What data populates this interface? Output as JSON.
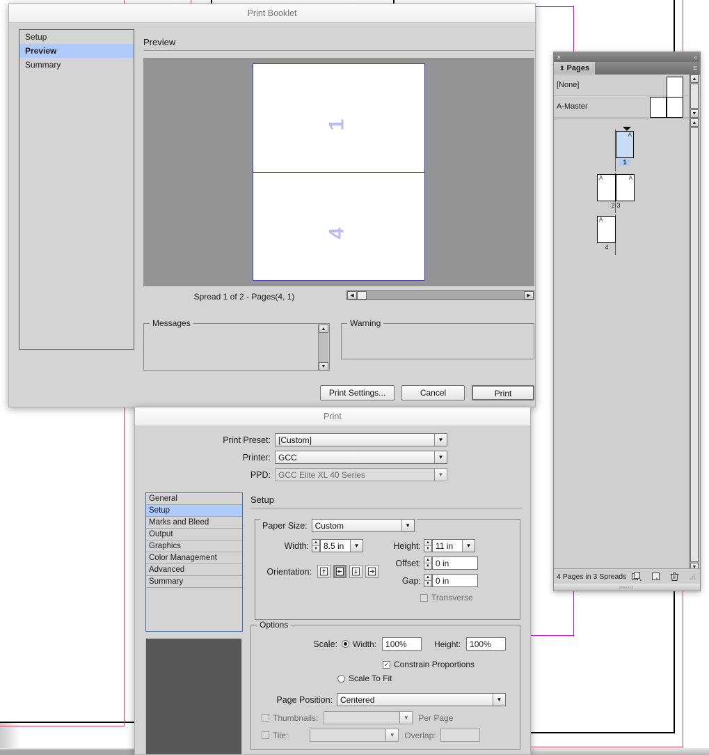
{
  "canvas": {
    "guide_magenta": "#e600e6",
    "guide_violet": "#8a2be2",
    "guide_red": "#e8415c",
    "page_border": "#000000"
  },
  "print_booklet": {
    "title": "Print Booklet",
    "nav_items": [
      {
        "label": "Setup",
        "selected": false
      },
      {
        "label": "Preview",
        "selected": true
      },
      {
        "label": "Summary",
        "selected": false
      }
    ],
    "preview_label": "Preview",
    "spread_caption": "Spread 1 of 2 - Pages(4, 1)",
    "preview_page_top": "1",
    "preview_page_bottom": "4",
    "messages_legend": "Messages",
    "messages_value": "",
    "warning_legend": "Warning",
    "warning_value": "",
    "buttons": {
      "print_settings": "Print Settings...",
      "cancel": "Cancel",
      "print": "Print"
    },
    "scroll_left_icon": "◀",
    "scroll_right_icon": "▶",
    "scroll_up_icon": "▲",
    "scroll_down_icon": "▼"
  },
  "print_dialog": {
    "title": "Print",
    "preset_label": "Print Preset:",
    "preset_value": "[Custom]",
    "printer_label": "Printer:",
    "printer_value": "GCC",
    "ppd_label": "PPD:",
    "ppd_value": "GCC Elite XL 40 Series",
    "nav_items": [
      {
        "label": "General",
        "selected": false
      },
      {
        "label": "Setup",
        "selected": true
      },
      {
        "label": "Marks and Bleed",
        "selected": false
      },
      {
        "label": "Output",
        "selected": false
      },
      {
        "label": "Graphics",
        "selected": false
      },
      {
        "label": "Color Management",
        "selected": false
      },
      {
        "label": "Advanced",
        "selected": false
      },
      {
        "label": "Summary",
        "selected": false
      }
    ],
    "panel_title": "Setup",
    "paper": {
      "legend": "Paper Size:",
      "paper_size_value": "Custom",
      "width_label": "Width:",
      "width_value": "8.5 in",
      "height_label": "Height:",
      "height_value": "11 in",
      "offset_label": "Offset:",
      "offset_value": "0 in",
      "gap_label": "Gap:",
      "gap_value": "0 in",
      "orientation_label": "Orientation:",
      "transverse_label": "Transverse",
      "transverse_checked": false,
      "orientation_selected_index": 1
    },
    "options": {
      "legend": "Options",
      "scale_label": "Scale:",
      "scale_width_label": "Width:",
      "scale_width_value": "100%",
      "scale_height_label": "Height:",
      "scale_height_value": "100%",
      "constrain_label": "Constrain Proportions",
      "constrain_checked": true,
      "check_glyph": "✓",
      "scale_to_fit_label": "Scale To Fit",
      "scale_mode": "width",
      "page_position_label": "Page Position:",
      "page_position_value": "Centered",
      "thumbnails_label": "Thumbnails:",
      "thumbnails_value": "",
      "per_page_label": "Per Page",
      "tile_label": "Tile:",
      "tile_value": "",
      "overlap_label": "Overlap:",
      "overlap_value": ""
    },
    "dropdown_arrow": "▼"
  },
  "pages_panel": {
    "close_icon": "✕",
    "collapse_icon": "«",
    "tab_label": "Pages",
    "tab_grip": "⇕",
    "menu_icon": "≡",
    "masters": [
      {
        "label": "[None]",
        "spread": false
      },
      {
        "label": "A-Master",
        "spread": true
      }
    ],
    "pages": [
      {
        "label": "1",
        "marker": "A",
        "selected": true,
        "spread": false
      },
      {
        "label": "2-3",
        "marker": "A",
        "selected": false,
        "spread": true
      },
      {
        "label": "4",
        "marker": "A",
        "selected": false,
        "spread": false
      }
    ],
    "footer_status": "4 Pages in 3 Spreads",
    "footer_icons": [
      "new-page-icon",
      "duplicate-page-icon",
      "delete-page-icon"
    ],
    "scroll_up_icon": "▲",
    "scroll_down_icon": "▼"
  }
}
